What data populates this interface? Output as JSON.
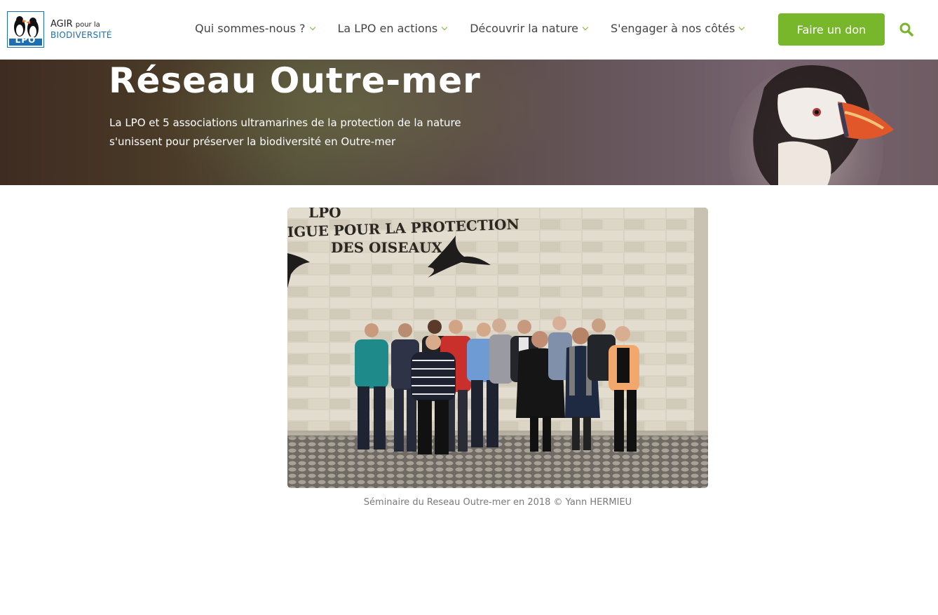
{
  "header": {
    "logo": {
      "top_text": "AGIR",
      "top_small": "pour la",
      "bottom_text": "BIODIVERSITÉ",
      "badge": "LPO"
    },
    "nav": [
      {
        "label": "Qui sommes-nous ?"
      },
      {
        "label": "La LPO en actions"
      },
      {
        "label": "Découvrir la nature"
      },
      {
        "label": "S'engager à nos côtés"
      }
    ],
    "donate_label": "Faire un don",
    "search_icon": "search-icon"
  },
  "hero": {
    "title": "Réseau Outre-mer",
    "subtitle": "La LPO et 5 associations ultramarines de la protection de la nature s'unissent pour préserver la biodiversité en Outre-mer"
  },
  "photo": {
    "wall_text_1": "LPO",
    "wall_text_2": "IGUE POUR LA PROTECTION",
    "wall_text_3": "DES OISEAUX",
    "caption": "Séminaire du Reseau Outre-mer en 2018 © Yann HERMIEU"
  },
  "colors": {
    "accent": "#78b62c",
    "brand_blue": "#1d6fb3"
  }
}
